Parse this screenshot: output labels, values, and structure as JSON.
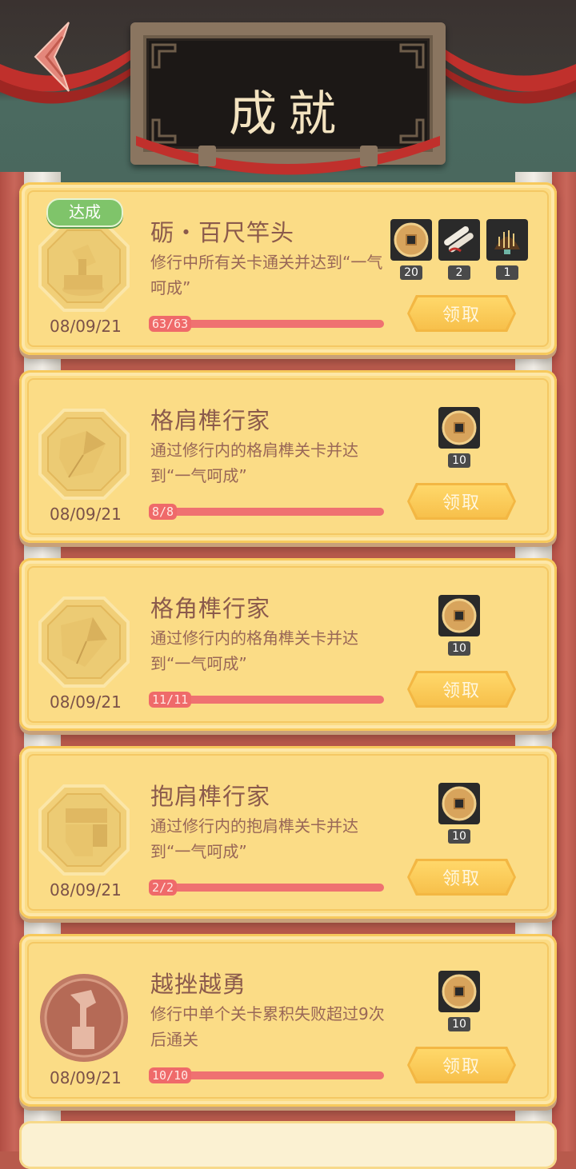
{
  "header": {
    "title": "成就"
  },
  "achievements": [
    {
      "badge": "axe-stump-badge-icon",
      "achieved_tag": "达成",
      "title": "砺・百尺竿头",
      "desc": "修行中所有关卡通关并达到“一气呵成”",
      "date": "08/09/21",
      "progress_text": "63/63",
      "progress": 1.0,
      "rewards": [
        {
          "icon": "copper-coin-icon",
          "count": "20"
        },
        {
          "icon": "scroll-bundle-icon",
          "count": "2"
        },
        {
          "icon": "wooden-comb-icon",
          "count": "1"
        }
      ],
      "claim_label": "领取"
    },
    {
      "badge": "shoulder-joint-badge-icon",
      "title": "格肩榫行家",
      "desc": "通过修行内的格肩榫关卡并达到“一气呵成”",
      "date": "08/09/21",
      "progress_text": "8/8",
      "progress": 1.0,
      "rewards": [
        {
          "icon": "copper-coin-icon",
          "count": "10"
        }
      ],
      "claim_label": "领取"
    },
    {
      "badge": "corner-joint-badge-icon",
      "title": "格角榫行家",
      "desc": "通过修行内的格角榫关卡并达到“一气呵成”",
      "date": "08/09/21",
      "progress_text": "11/11",
      "progress": 1.0,
      "rewards": [
        {
          "icon": "copper-coin-icon",
          "count": "10"
        }
      ],
      "claim_label": "领取"
    },
    {
      "badge": "hug-shoulder-joint-badge-icon",
      "title": "抱肩榫行家",
      "desc": "通过修行内的抱肩榫关卡并达到“一气呵成”",
      "date": "08/09/21",
      "progress_text": "2/2",
      "progress": 1.0,
      "rewards": [
        {
          "icon": "copper-coin-icon",
          "count": "10"
        }
      ],
      "claim_label": "领取"
    },
    {
      "badge": "fist-axe-badge-icon",
      "title": "越挫越勇",
      "desc": "修行中单个关卡累积失败超过9次后通关",
      "date": "08/09/21",
      "progress_text": "10/10",
      "progress": 1.0,
      "rewards": [
        {
          "icon": "copper-coin-icon",
          "count": "10"
        }
      ],
      "claim_label": "领取"
    }
  ],
  "colors": {
    "card": "#fbdc86",
    "title_text": "#8b5a4c",
    "progress": "#ef7171",
    "achieved_tag": "#7fc46a"
  }
}
